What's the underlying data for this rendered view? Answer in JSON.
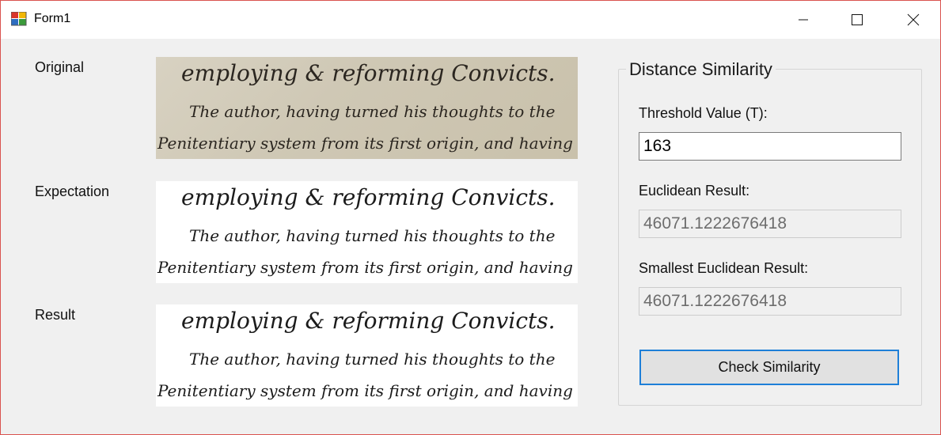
{
  "window": {
    "title": "Form1"
  },
  "rows": {
    "original_label": "Original",
    "expectation_label": "Expectation",
    "result_label": "Result"
  },
  "handwriting": {
    "line1": "employing & reforming Convicts.",
    "line2": "The author, having turned his thoughts to the",
    "line3": "Penitentiary system from its first origin, and having"
  },
  "group": {
    "title": "Distance Similarity",
    "threshold_label": "Threshold Value (T):",
    "threshold_value": "163",
    "euclidean_label": "Euclidean Result:",
    "euclidean_value": "46071.1222676418",
    "smallest_label": "Smallest Euclidean Result:",
    "smallest_value": "46071.1222676418",
    "check_button": "Check Similarity"
  },
  "colors": {
    "window_border": "#d9534f",
    "button_focus_border": "#1e7fd8",
    "form_background": "#f0f0f0"
  },
  "icons": {
    "app": "form-app-icon",
    "minimize": "minimize-icon",
    "maximize": "maximize-icon",
    "close": "close-icon"
  }
}
